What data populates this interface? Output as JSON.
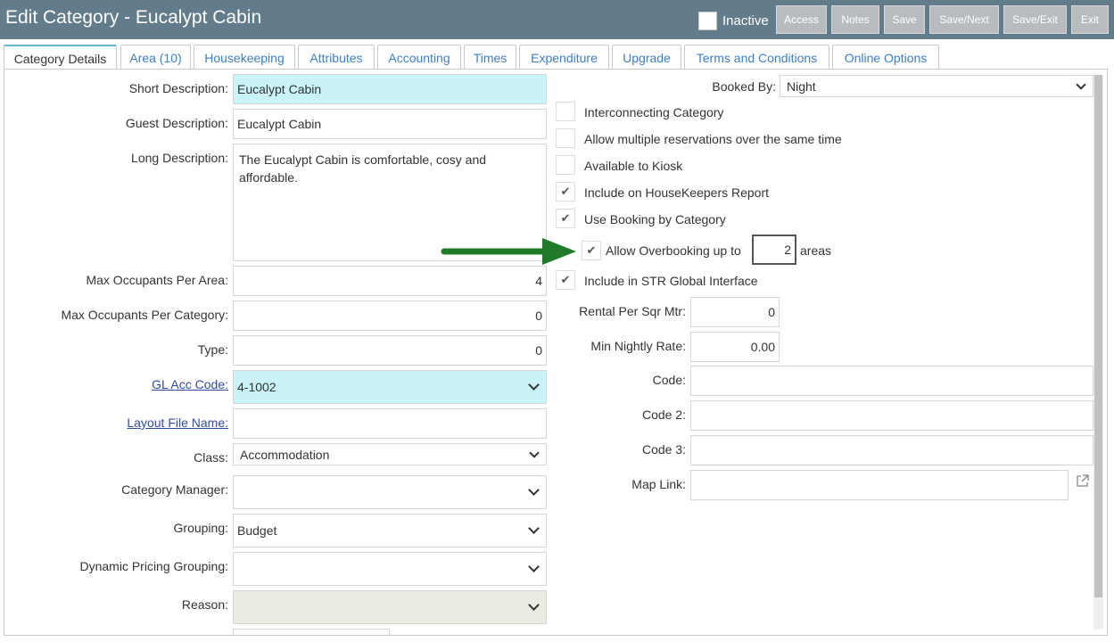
{
  "header": {
    "title": "Edit Category - Eucalypt Cabin",
    "inactive_label": "Inactive",
    "buttons": {
      "access": "Access",
      "notes": "Notes",
      "save": "Save",
      "save_next": "Save/Next",
      "save_exit": "Save/Exit",
      "exit": "Exit"
    }
  },
  "tabs": [
    "Category Details",
    "Area (10)",
    "Housekeeping",
    "Attributes",
    "Accounting",
    "Times",
    "Expenditure",
    "Upgrade",
    "Terms and Conditions",
    "Online Options"
  ],
  "left": {
    "short_desc": {
      "label": "Short Description:",
      "value": "Eucalypt Cabin"
    },
    "guest_desc": {
      "label": "Guest Description:",
      "value": "Eucalypt Cabin"
    },
    "long_desc": {
      "label": "Long Description:",
      "value": "The Eucalypt Cabin is comfortable, cosy and affordable."
    },
    "max_occ_area": {
      "label": "Max Occupants Per Area:",
      "value": "4"
    },
    "max_occ_cat": {
      "label": "Max Occupants Per Category:",
      "value": "0"
    },
    "type": {
      "label": "Type:",
      "value": "0"
    },
    "gl_acc": {
      "label": "GL Acc Code:",
      "value": "4-1002"
    },
    "layout_file": {
      "label": "Layout File Name:",
      "value": ""
    },
    "class": {
      "label": "Class:",
      "value": "Accommodation"
    },
    "cat_manager": {
      "label": "Category Manager:",
      "value": ""
    },
    "grouping": {
      "label": "Grouping:",
      "value": "Budget"
    },
    "dyn_pricing": {
      "label": "Dynamic Pricing Grouping:",
      "value": ""
    },
    "reason": {
      "label": "Reason:",
      "value": ""
    }
  },
  "right": {
    "booked_by": {
      "label": "Booked By:",
      "value": "Night"
    },
    "checkboxes": {
      "interconnecting": {
        "label": "Interconnecting Category",
        "checked": false
      },
      "multi_res": {
        "label": "Allow multiple reservations over the same time",
        "checked": false
      },
      "kiosk": {
        "label": "Available to Kiosk",
        "checked": false
      },
      "housekeepers": {
        "label": "Include on HouseKeepers Report",
        "checked": true
      },
      "booking_by_cat": {
        "label": "Use Booking by Category",
        "checked": true
      },
      "overbooking": {
        "label": "Allow Overbooking up to",
        "checked": true,
        "value": "2",
        "suffix": "areas"
      },
      "str_global": {
        "label": "Include in STR Global Interface",
        "checked": true
      }
    },
    "rental_sqm": {
      "label": "Rental Per Sqr Mtr:",
      "value": "0"
    },
    "min_nightly": {
      "label": "Min Nightly Rate:",
      "value": "0.00"
    },
    "code": {
      "label": "Code:",
      "value": ""
    },
    "code2": {
      "label": "Code 2:",
      "value": ""
    },
    "code3": {
      "label": "Code 3:",
      "value": ""
    },
    "map_link": {
      "label": "Map Link:",
      "value": ""
    }
  },
  "colors": {
    "header": "#627c8b",
    "highlight": "#c9f3f8",
    "link": "#3d7fc4",
    "arrow": "#1f7a2a"
  },
  "icons": {
    "check": "✔",
    "external_link": "external-link-icon",
    "arrow": "green-arrow-icon"
  }
}
